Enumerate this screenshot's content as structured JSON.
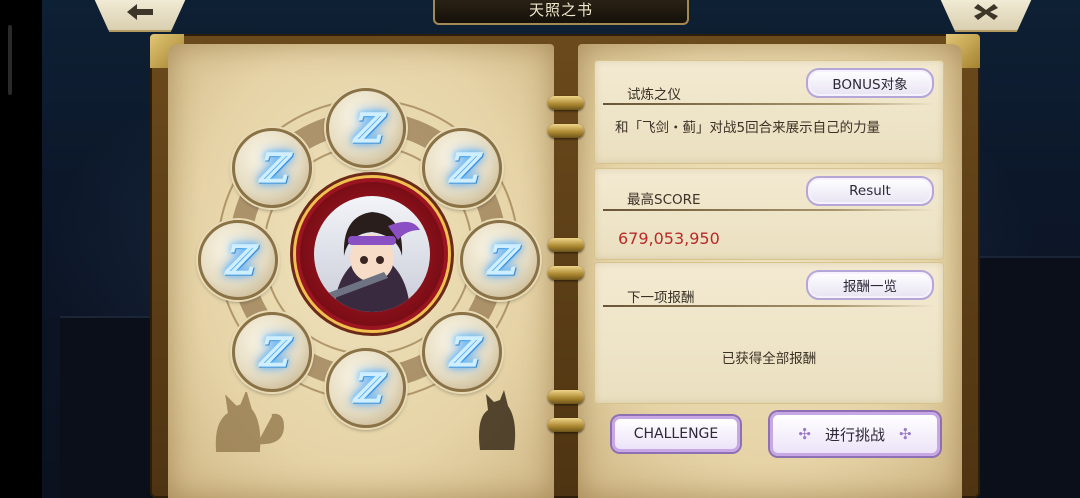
{
  "header": {
    "title": "天照之书",
    "back_icon": "back-arrow-icon",
    "close_icon": "close-icon"
  },
  "runes": [
    "ℤ",
    "ℤ",
    "ℤ",
    "ℤ",
    "ℤ",
    "ℤ",
    "ℤ",
    "ℤ"
  ],
  "trial": {
    "label": "试炼之仪",
    "bonus_button": "BONUS对象",
    "description": "和「飞剑・蓟」对战5回合来展示自己的力量"
  },
  "score": {
    "label": "最高SCORE",
    "result_button": "Result",
    "value": "679,053,950"
  },
  "reward": {
    "label": "下一项报酬",
    "list_button": "报酬一览",
    "status": "已获得全部报酬"
  },
  "actions": {
    "challenge": "CHALLENGE",
    "start": "进行挑战"
  },
  "colors": {
    "score": "#b82a2a",
    "rune_glow": "#5fc0ff",
    "button_border": "#c7a7e4"
  }
}
